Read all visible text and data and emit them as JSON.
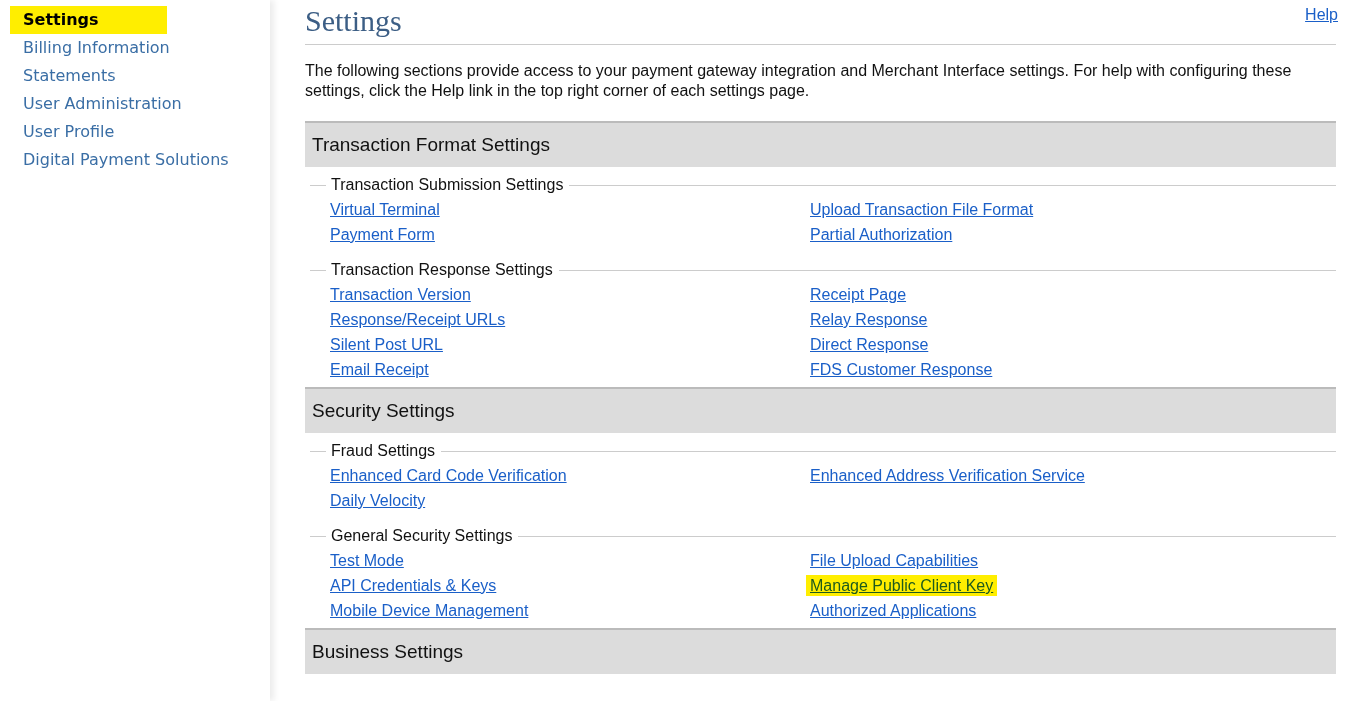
{
  "sidebar": {
    "items": [
      {
        "label": "Settings",
        "selected": true,
        "highlighted": true
      },
      {
        "label": "Billing Information",
        "selected": false,
        "highlighted": false
      },
      {
        "label": "Statements",
        "selected": false,
        "highlighted": false
      },
      {
        "label": "User Administration",
        "selected": false,
        "highlighted": false
      },
      {
        "label": "User Profile",
        "selected": false,
        "highlighted": false
      },
      {
        "label": "Digital Payment Solutions",
        "selected": false,
        "highlighted": false
      }
    ]
  },
  "page": {
    "title": "Settings",
    "help_link": "Help",
    "intro": "The following sections provide access to your payment gateway integration and Merchant Interface settings. For help with configuring these settings, click the Help link in the top right corner of each settings page."
  },
  "sections": [
    {
      "title": "Transaction Format Settings",
      "groups": [
        {
          "title": "Transaction Submission Settings",
          "links": [
            {
              "label": "Virtual Terminal",
              "highlighted": false
            },
            {
              "label": "Upload Transaction File Format",
              "highlighted": false
            },
            {
              "label": "Payment Form",
              "highlighted": false
            },
            {
              "label": "Partial Authorization",
              "highlighted": false
            }
          ]
        },
        {
          "title": "Transaction Response Settings",
          "links": [
            {
              "label": "Transaction Version",
              "highlighted": false
            },
            {
              "label": "Receipt Page",
              "highlighted": false
            },
            {
              "label": "Response/Receipt URLs",
              "highlighted": false
            },
            {
              "label": "Relay Response",
              "highlighted": false
            },
            {
              "label": "Silent Post URL",
              "highlighted": false
            },
            {
              "label": "Direct Response",
              "highlighted": false
            },
            {
              "label": "Email Receipt",
              "highlighted": false
            },
            {
              "label": "FDS Customer Response",
              "highlighted": false
            }
          ]
        }
      ]
    },
    {
      "title": "Security Settings",
      "groups": [
        {
          "title": "Fraud Settings",
          "links": [
            {
              "label": "Enhanced Card Code Verification",
              "highlighted": false
            },
            {
              "label": "Enhanced Address Verification Service",
              "highlighted": false
            },
            {
              "label": "Daily Velocity",
              "highlighted": false
            }
          ]
        },
        {
          "title": "General Security Settings",
          "links": [
            {
              "label": "Test Mode",
              "highlighted": false
            },
            {
              "label": "File Upload Capabilities",
              "highlighted": false
            },
            {
              "label": "API Credentials & Keys",
              "highlighted": false
            },
            {
              "label": "Manage Public Client Key",
              "highlighted": true
            },
            {
              "label": "Mobile Device Management",
              "highlighted": false
            },
            {
              "label": "Authorized Applications",
              "highlighted": false
            }
          ]
        }
      ]
    },
    {
      "title": "Business Settings"
    }
  ]
}
